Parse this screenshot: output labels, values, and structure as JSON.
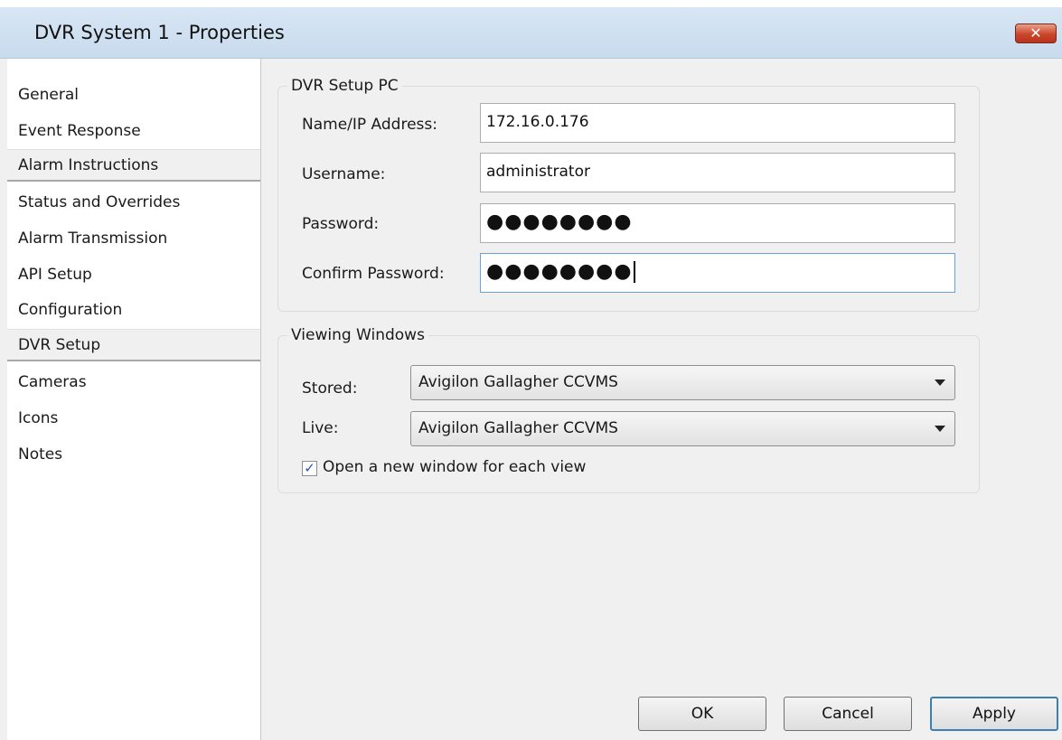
{
  "window": {
    "title": "DVR System 1 - Properties",
    "close_glyph": "✕"
  },
  "sidebar": {
    "items": [
      {
        "label": "General"
      },
      {
        "label": "Event Response"
      },
      {
        "label": "Alarm Instructions"
      },
      {
        "label": "Status and Overrides"
      },
      {
        "label": "Alarm Transmission"
      },
      {
        "label": "API Setup"
      },
      {
        "label": "Configuration"
      },
      {
        "label": "DVR Setup"
      },
      {
        "label": "Cameras"
      },
      {
        "label": "Icons"
      },
      {
        "label": "Notes"
      }
    ]
  },
  "dvr_setup_pc": {
    "legend": "DVR Setup PC",
    "name_ip_label": "Name/IP Address:",
    "name_ip_value": "172.16.0.176",
    "username_label": "Username:",
    "username_value": "administrator",
    "password_label": "Password:",
    "password_value": "●●●●●●●●",
    "confirm_label": "Confirm Password:",
    "confirm_value": "●●●●●●●●"
  },
  "viewing_windows": {
    "legend": "Viewing Windows",
    "stored_label": "Stored:",
    "stored_value": "Avigilon Gallagher CCVMS",
    "live_label": "Live:",
    "live_value": "Avigilon Gallagher CCVMS",
    "new_window_label": "Open a new window for each view",
    "new_window_checked": true,
    "check_glyph": "✓"
  },
  "buttons": {
    "ok": "OK",
    "cancel": "Cancel",
    "apply": "Apply"
  }
}
